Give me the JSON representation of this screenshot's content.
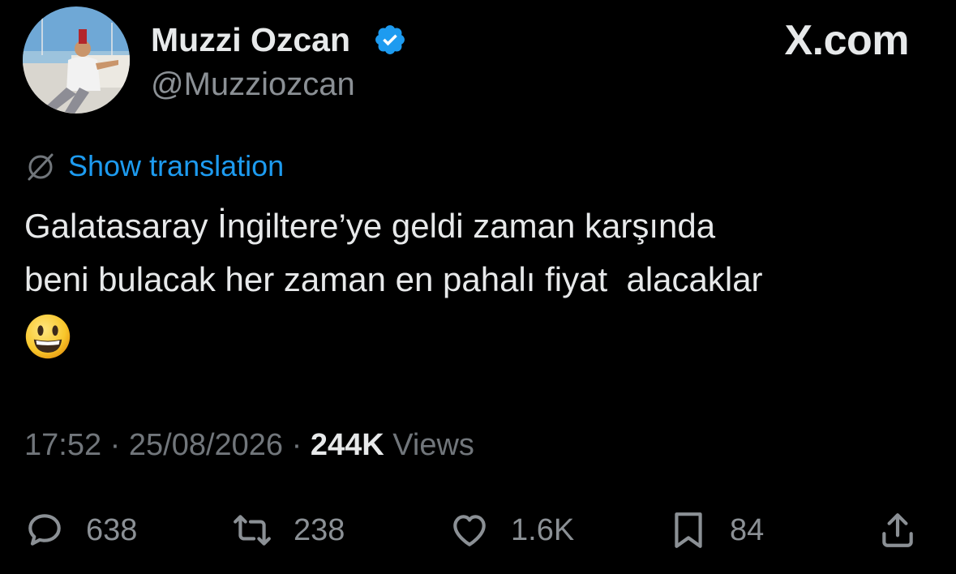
{
  "header": {
    "display_name": "Muzzi Ozcan",
    "handle": "@Muzziozcan",
    "verified": true,
    "site_brand": "X.com"
  },
  "translation": {
    "label": "Show translation",
    "icon": "globe-slash-icon"
  },
  "tweet": {
    "text": "Galatasaray İngiltere’ye geldi zaman karşında\nbeni bulacak her zaman en pahalı fiyat  alacaklar",
    "emoji": "😀"
  },
  "meta": {
    "time": "17:52",
    "separator": "·",
    "date": "25/08/2026",
    "views_count": "244K",
    "views_label": "Views"
  },
  "actions": {
    "replies": "638",
    "retweets": "238",
    "likes": "1.6K",
    "bookmarks": "84"
  },
  "colors": {
    "background": "#000000",
    "accent": "#1d9bf0",
    "text_primary": "#e7e9ea",
    "text_secondary": "#71767b"
  }
}
